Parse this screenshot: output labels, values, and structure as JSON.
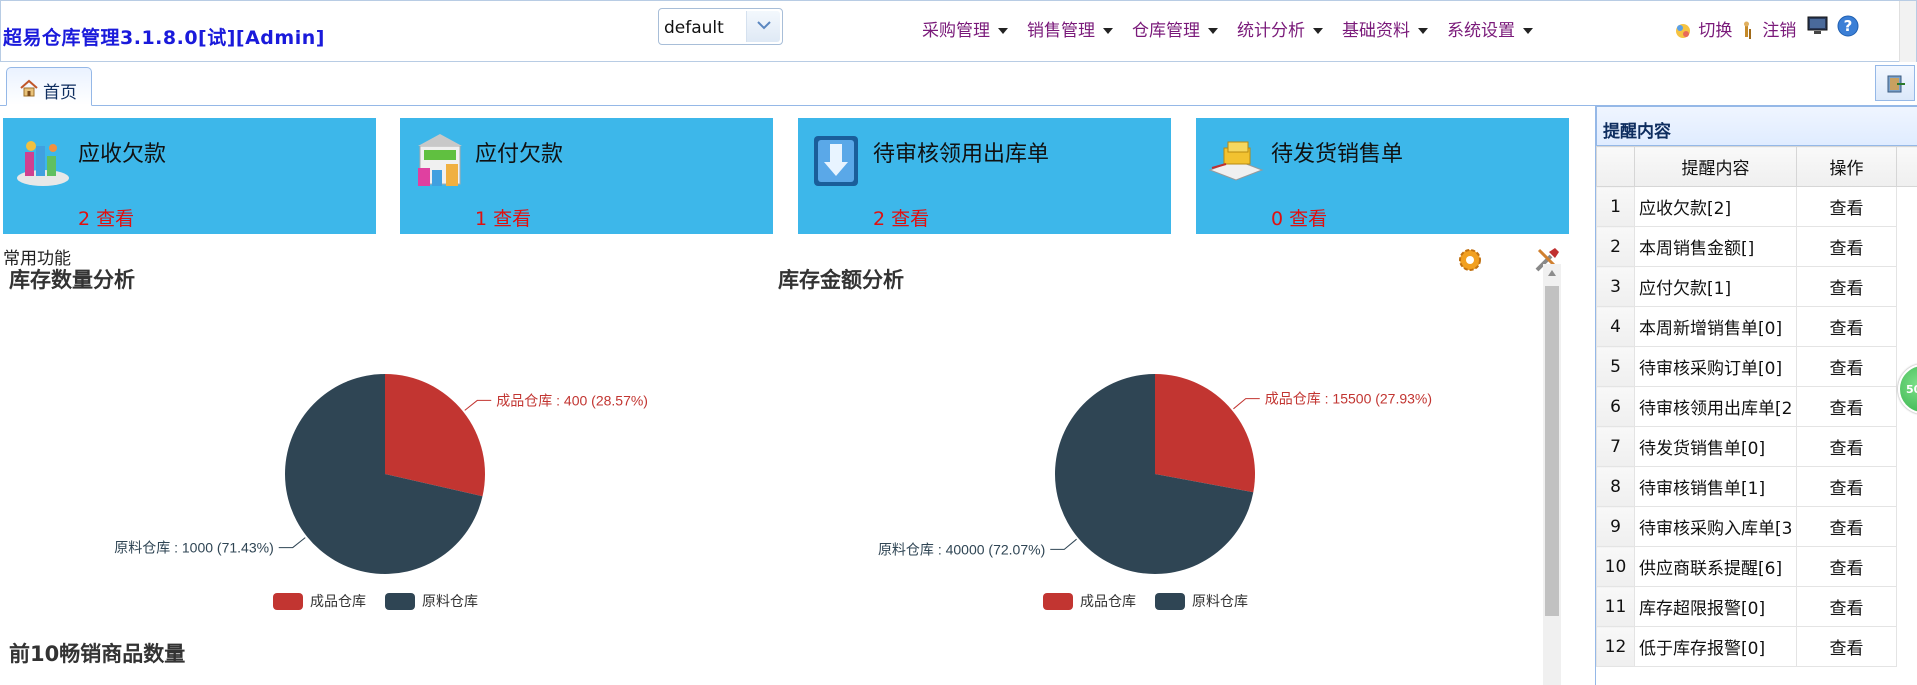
{
  "header": {
    "title": "超易仓库管理3.1.8.0[试][Admin]",
    "db_select_value": "default",
    "menus": [
      "采购管理",
      "销售管理",
      "仓库管理",
      "统计分析",
      "基础资料",
      "系统设置"
    ],
    "switch_label": "切换",
    "logout_label": "注销"
  },
  "tabs": {
    "home": "首页"
  },
  "cards": [
    {
      "title": "应收欠款",
      "count": "2 查看",
      "icon": "receivable-icon"
    },
    {
      "title": "应付欠款",
      "count": "1 查看",
      "icon": "payable-icon"
    },
    {
      "title": "待审核领用出库单",
      "count": "2 查看",
      "icon": "download-box-icon"
    },
    {
      "title": "待发货销售单",
      "count": "0 查看",
      "icon": "shipping-icon"
    }
  ],
  "section": {
    "title": "常用功能"
  },
  "chart_titles": {
    "qty": "库存数量分析",
    "amount": "库存金额分析",
    "top10": "前10畅销商品数量"
  },
  "chart_data": [
    {
      "type": "pie",
      "title": "库存数量分析",
      "labels": [
        "成品仓库",
        "原料仓库"
      ],
      "values": [
        400,
        1000
      ],
      "percents": [
        "28.57%",
        "71.43%"
      ],
      "slice_labels": [
        "成品仓库 : 400 (28.57%)",
        "原料仓库 : 1000 (71.43%)"
      ],
      "colors": [
        "#c23531",
        "#2f4554"
      ],
      "legend": [
        "成品仓库",
        "原料仓库"
      ],
      "legend_position": "bottom"
    },
    {
      "type": "pie",
      "title": "库存金额分析",
      "labels": [
        "成品仓库",
        "原料仓库"
      ],
      "values": [
        15500,
        40000
      ],
      "percents": [
        "27.93%",
        "72.07%"
      ],
      "slice_labels": [
        "成品仓库 : 15500 (27.93%)",
        "原料仓库 : 40000 (72.07%)"
      ],
      "colors": [
        "#c23531",
        "#2f4554"
      ],
      "legend": [
        "成品仓库",
        "原料仓库"
      ],
      "legend_position": "bottom"
    }
  ],
  "reminders": {
    "panel_title": "提醒内容",
    "col_content": "提醒内容",
    "col_action": "操作",
    "rows": [
      {
        "n": "1",
        "text": "应收欠款[2]",
        "action": "查看"
      },
      {
        "n": "2",
        "text": "本周销售金额[]",
        "action": "查看"
      },
      {
        "n": "3",
        "text": "应付欠款[1]",
        "action": "查看"
      },
      {
        "n": "4",
        "text": "本周新增销售单[0]",
        "action": "查看"
      },
      {
        "n": "5",
        "text": "待审核采购订单[0]",
        "action": "查看"
      },
      {
        "n": "6",
        "text": "待审核领用出库单[2",
        "action": "查看"
      },
      {
        "n": "7",
        "text": "待发货销售单[0]",
        "action": "查看"
      },
      {
        "n": "8",
        "text": "待审核销售单[1]",
        "action": "查看"
      },
      {
        "n": "9",
        "text": "待审核采购入库单[3",
        "action": "查看"
      },
      {
        "n": "10",
        "text": "供应商联系提醒[6]",
        "action": "查看"
      },
      {
        "n": "11",
        "text": "库存超限报警[0]",
        "action": "查看"
      },
      {
        "n": "12",
        "text": "低于库存报警[0]",
        "action": "查看"
      }
    ]
  },
  "float_ball": "50"
}
